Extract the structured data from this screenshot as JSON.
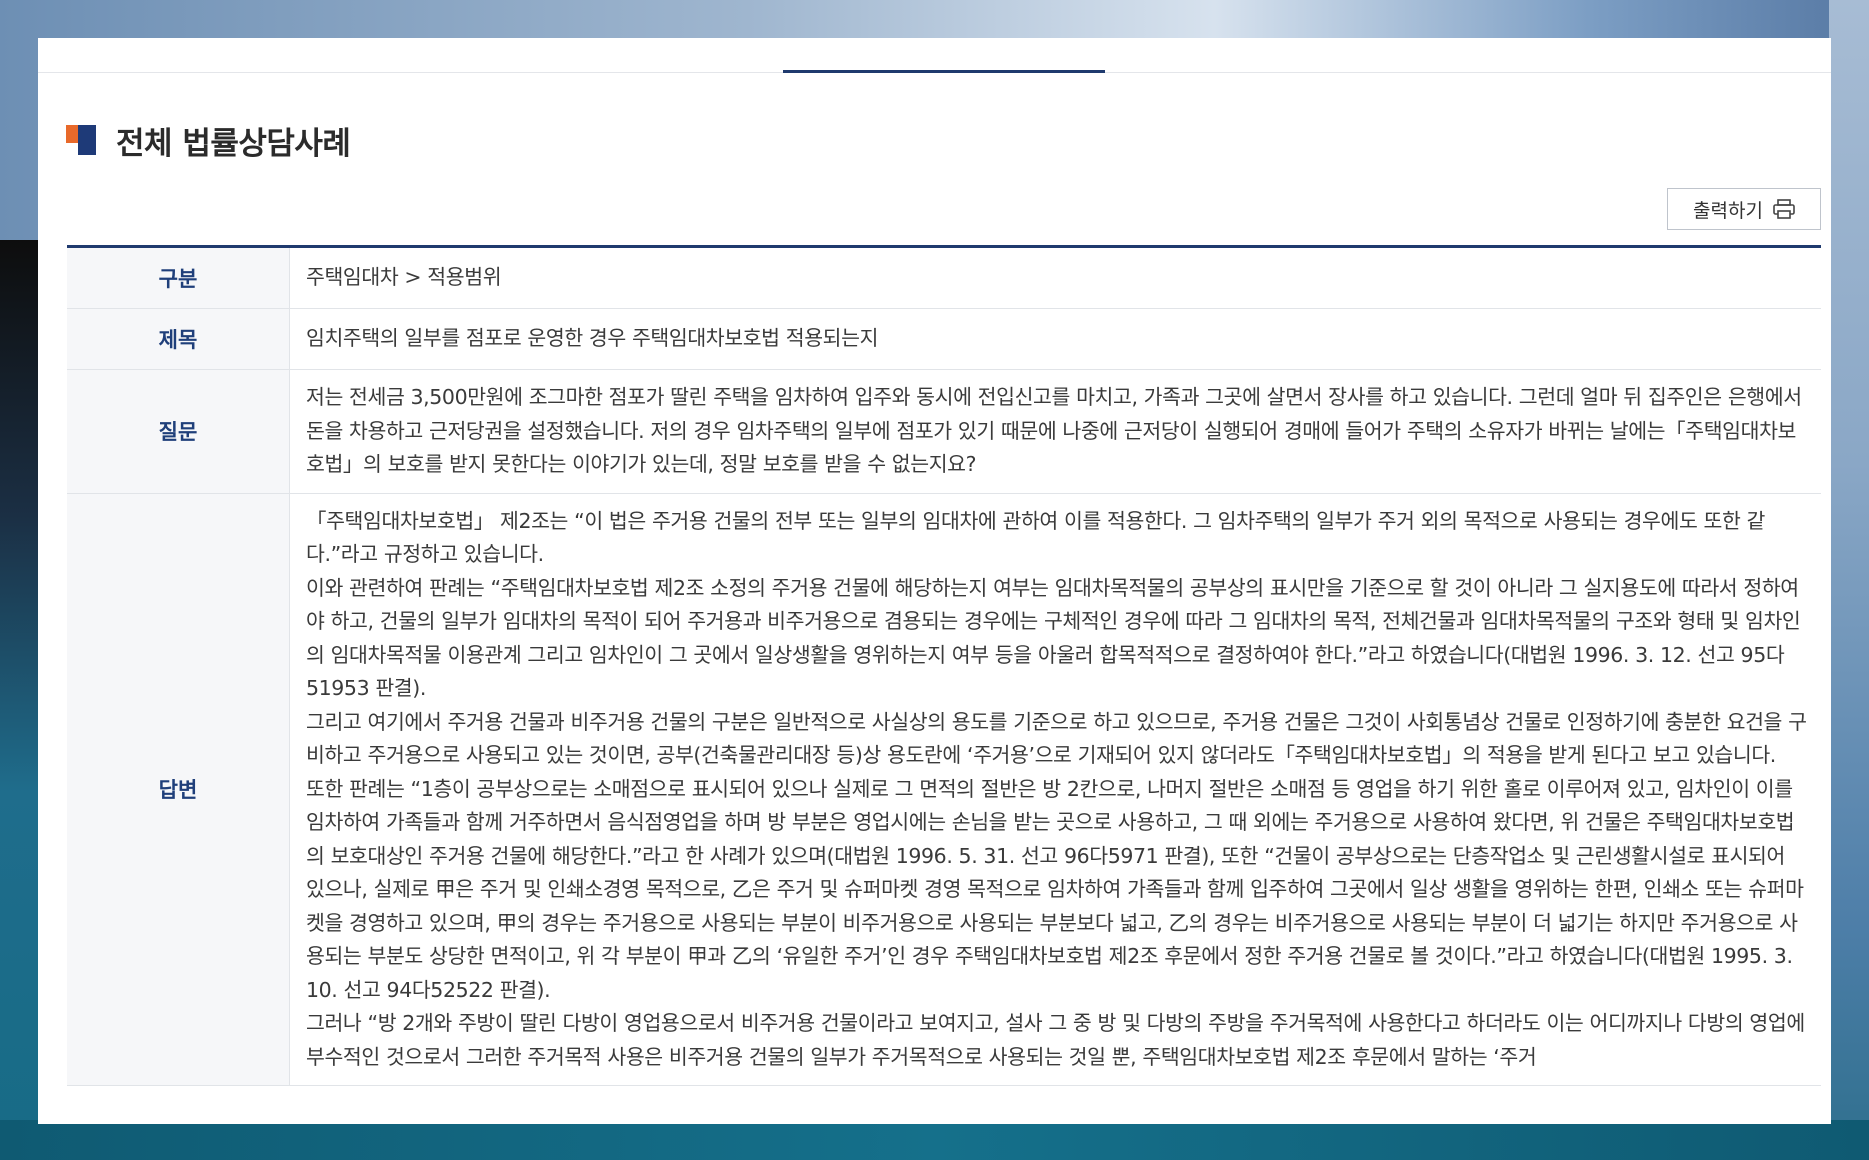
{
  "page": {
    "heading": "전체 법률상담사례",
    "print_button": "출력하기",
    "icons": {
      "heading_mark": "section-title-mark",
      "print": "printer-icon"
    },
    "colors": {
      "accent_navy": "#1f3a6e",
      "accent_orange": "#e8692a",
      "label_text": "#1f3f7a"
    }
  },
  "table": {
    "category_label": "구분",
    "category_value": "주택임대차 > 적용범위",
    "title_label": "제목",
    "title_value": "임치주택의 일부를 점포로 운영한 경우 주택임대차보호법 적용되는지",
    "question_label": "질문",
    "question_value": "저는 전세금 3,500만원에 조그마한 점포가 딸린 주택을 임차하여 입주와 동시에 전입신고를 마치고, 가족과 그곳에 살면서 장사를 하고 있습니다. 그런데 얼마 뒤 집주인은 은행에서 돈을 차용하고 근저당권을 설정했습니다. 저의 경우 임차주택의 일부에 점포가 있기 때문에 나중에 근저당이 실행되어 경매에 들어가 주택의 소유자가 바뀌는 날에는「주택임대차보호법」의 보호를 받지 못한다는 이야기가 있는데, 정말 보호를 받을 수 없는지요?",
    "answer_label": "답변",
    "answer_paragraphs": [
      "「주택임대차보호법」 제2조는 “이 법은 주거용 건물의 전부 또는 일부의 임대차에 관하여 이를 적용한다. 그 임차주택의 일부가 주거 외의 목적으로 사용되는 경우에도 또한 같다.”라고 규정하고 있습니다.",
      "이와 관련하여 판례는 “주택임대차보호법 제2조 소정의 주거용 건물에 해당하는지 여부는 임대차목적물의 공부상의 표시만을 기준으로 할 것이 아니라 그 실지용도에 따라서 정하여야 하고, 건물의 일부가 임대차의 목적이 되어 주거용과 비주거용으로 겸용되는 경우에는 구체적인 경우에 따라 그 임대차의 목적, 전체건물과 임대차목적물의 구조와 형태 및 임차인의 임대차목적물 이용관계 그리고 임차인이 그 곳에서 일상생활을 영위하는지 여부 등을 아울러 합목적적으로 결정하여야 한다.”라고 하였습니다(대법원 1996. 3. 12. 선고 95다51953 판결).",
      "그리고 여기에서 주거용 건물과 비주거용 건물의 구분은 일반적으로 사실상의 용도를 기준으로 하고 있으므로, 주거용 건물은 그것이 사회통념상 건물로 인정하기에 충분한 요건을 구비하고 주거용으로 사용되고 있는 것이면, 공부(건축물관리대장 등)상 용도란에 ‘주거용’으로 기재되어 있지 않더라도「주택임대차보호법」의 적용을 받게 된다고 보고 있습니다.",
      "또한 판례는 “1층이 공부상으로는 소매점으로 표시되어 있으나 실제로 그 면적의 절반은 방 2칸으로, 나머지 절반은 소매점 등 영업을 하기 위한 홀로 이루어져 있고, 임차인이 이를 임차하여 가족들과 함께 거주하면서 음식점영업을 하며 방 부분은 영업시에는 손님을 받는 곳으로 사용하고, 그 때 외에는 주거용으로 사용하여 왔다면, 위 건물은 주택임대차보호법의 보호대상인 주거용 건물에 해당한다.”라고 한 사례가 있으며(대법원 1996. 5. 31. 선고 96다5971 판결), 또한 “건물이 공부상으로는 단층작업소 및 근린생활시설로 표시되어 있으나, 실제로 甲은 주거 및 인쇄소경영 목적으로, 乙은 주거 및 슈퍼마켓 경영 목적으로 임차하여 가족들과 함께 입주하여 그곳에서 일상 생활을 영위하는 한편, 인쇄소 또는 슈퍼마켓을 경영하고 있으며, 甲의 경우는 주거용으로 사용되는 부분이 비주거용으로 사용되는 부분보다 넓고, 乙의 경우는 비주거용으로 사용되는 부분이 더 넓기는 하지만 주거용으로 사용되는 부분도 상당한 면적이고, 위 각 부분이 甲과 乙의 ‘유일한 주거’인 경우 주택임대차보호법 제2조 후문에서 정한 주거용 건물로 볼 것이다.”라고 하였습니다(대법원 1995. 3. 10. 선고 94다52522 판결).",
      "그러나 “방 2개와 주방이 딸린 다방이 영업용으로서 비주거용 건물이라고 보여지고, 설사 그 중 방 및 다방의 주방을 주거목적에 사용한다고 하더라도 이는 어디까지나 다방의 영업에 부수적인 것으로서 그러한 주거목적 사용은 비주거용 건물의 일부가 주거목적으로 사용되는 것일 뿐, 주택임대차보호법 제2조 후문에서 말하는 ‘주거"
    ]
  }
}
